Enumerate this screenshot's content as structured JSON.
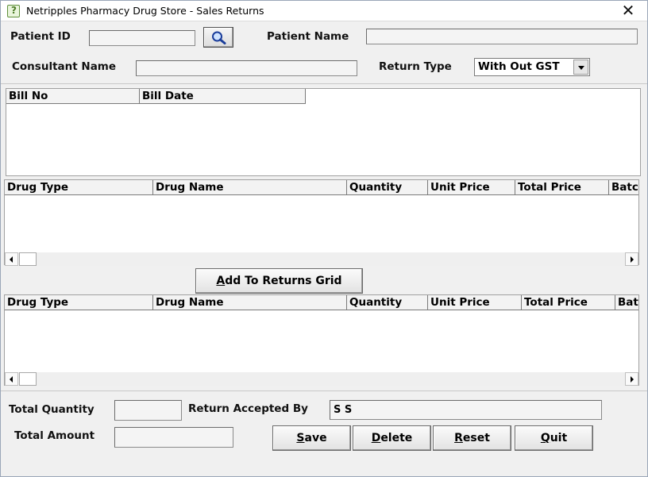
{
  "window": {
    "title": "Netripples Pharmacy Drug Store - Sales Returns",
    "close_glyph": "✕"
  },
  "form": {
    "patient_id_label": "Patient ID",
    "patient_id_value": "",
    "patient_name_label": "Patient Name",
    "patient_name_value": "",
    "consultant_name_label": "Consultant Name",
    "consultant_name_value": "",
    "return_type_label": "Return Type",
    "return_type_value": "With Out GST"
  },
  "bills_grid": {
    "columns": [
      "Bill No",
      "Bill Date"
    ]
  },
  "drugs_grid": {
    "columns": [
      "Drug Type",
      "Drug Name",
      "Quantity",
      "Unit Price",
      "Total Price",
      "Batc"
    ]
  },
  "add_button": {
    "label_first": "A",
    "label_rest": "dd To Returns Grid"
  },
  "returns_grid": {
    "columns": [
      "Drug Type",
      "Drug Name",
      "Quantity",
      "Unit Price",
      "Total Price",
      "Bat"
    ]
  },
  "footer": {
    "total_quantity_label": "Total Quantity",
    "total_quantity_value": "",
    "return_accepted_by_label": "Return Accepted By",
    "return_accepted_by_value": "S S",
    "total_amount_label": "Total Amount",
    "total_amount_value": ""
  },
  "buttons": {
    "save": {
      "first": "S",
      "rest": "ave"
    },
    "delete": {
      "first": "D",
      "rest": "elete"
    },
    "reset": {
      "first": "R",
      "rest": "eset"
    },
    "quit": {
      "first": "Q",
      "rest": "uit"
    }
  },
  "icons": {
    "app": "app-icon",
    "search": "magnifier-icon"
  },
  "colors": {
    "window_bg": "#f0f0f0",
    "grid_bg": "#ffffff",
    "header_bg": "#f3f3f3",
    "border": "#a0a0a0"
  }
}
